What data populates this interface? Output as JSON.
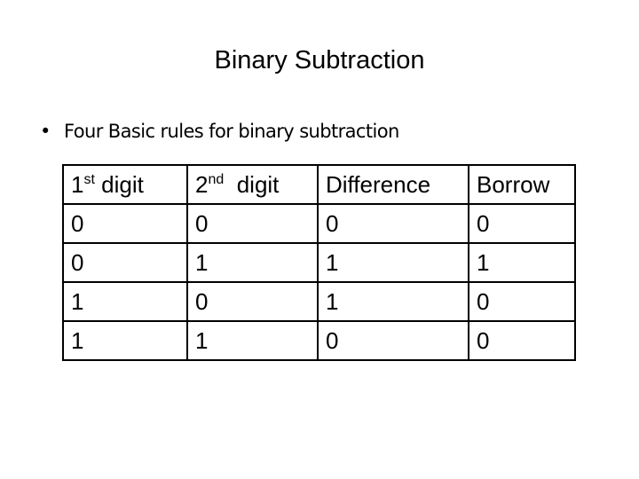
{
  "slide": {
    "title": "Binary Subtraction",
    "bullet": {
      "marker": "•",
      "text": "Four Basic rules for binary subtraction"
    },
    "table": {
      "headers": [
        {
          "base": "1",
          "sup": "st",
          "rest": " digit"
        },
        {
          "base": "2",
          "sup": "nd",
          "rest": "  digit"
        },
        {
          "base": "Difference",
          "sup": "",
          "rest": ""
        },
        {
          "base": "Borrow",
          "sup": "",
          "rest": ""
        }
      ],
      "rows": [
        [
          "0",
          "0",
          "0",
          "0"
        ],
        [
          "0",
          "1",
          "1",
          "1"
        ],
        [
          "1",
          "0",
          "1",
          "0"
        ],
        [
          "1",
          "1",
          "0",
          "0"
        ]
      ]
    }
  }
}
